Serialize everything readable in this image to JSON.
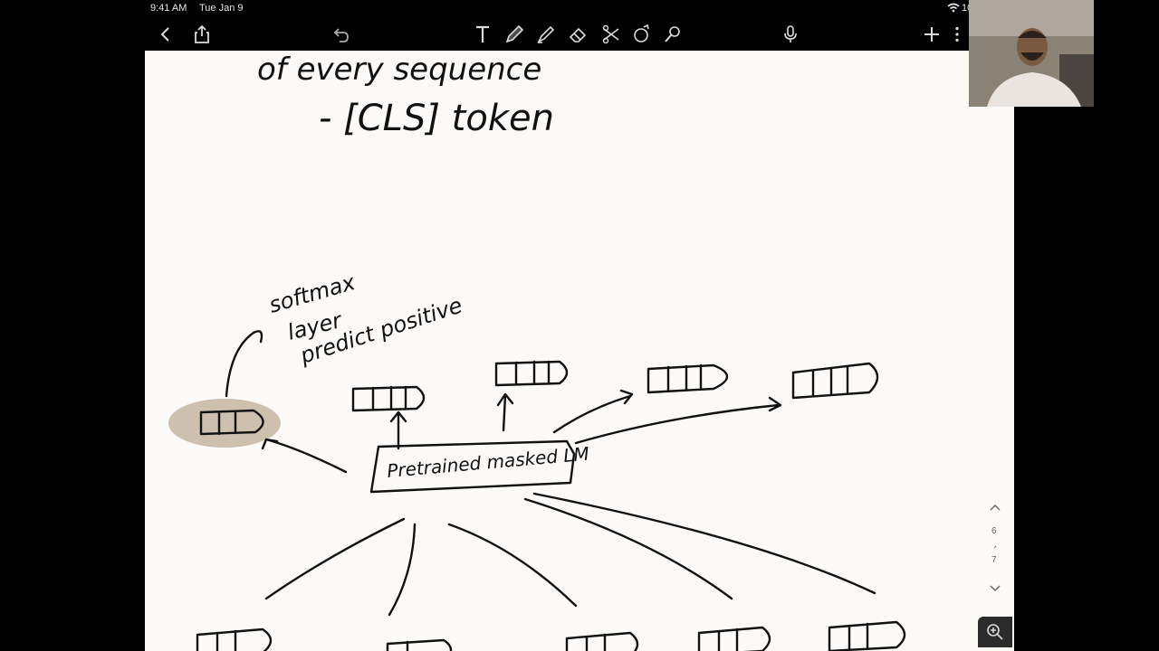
{
  "status_bar": {
    "time": "9:41 AM",
    "date": "Tue Jan 9",
    "battery": "10"
  },
  "toolbar": {
    "icons": [
      "back-icon",
      "share-icon",
      "undo-icon",
      "text-tool-icon",
      "pen-tool-icon",
      "highlighter-tool-icon",
      "eraser-tool-icon",
      "lasso-tool-icon",
      "shapes-tool-icon",
      "magic-tool-icon",
      "microphone-icon",
      "add-icon",
      "more-icon"
    ]
  },
  "page_nav": {
    "current": "6",
    "total": "7"
  },
  "note_ink": {
    "line1": "of every sequence",
    "line2": "- [CLS] token",
    "annotation_1": "softmax",
    "annotation_2": "layer",
    "annotation_3": "predict positive",
    "model_box": "Pretrained masked LM"
  },
  "colors": {
    "canvas": "#000000",
    "paper": "#fbfaf7",
    "ink": "#111111",
    "highlight": "#c9b9a6"
  }
}
